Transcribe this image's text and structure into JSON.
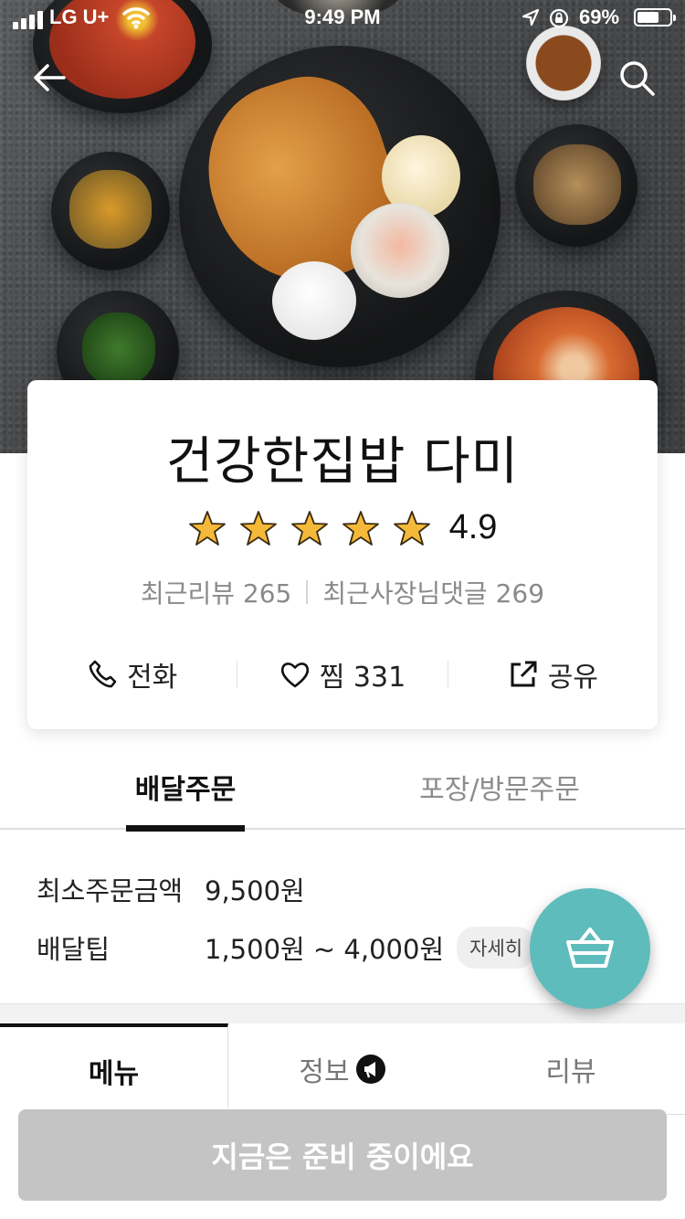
{
  "status_bar": {
    "carrier": "LG U+",
    "time": "9:49 PM",
    "battery_percent": "69%",
    "battery_level": 0.69
  },
  "nav": {
    "back_icon": "arrow-left-icon",
    "search_icon": "search-icon"
  },
  "store": {
    "name": "건강한집밥 다미",
    "rating": "4.9",
    "star_count": 5,
    "recent_reviews": "최근리뷰 265",
    "owner_replies": "최근사장님댓글 269"
  },
  "actions": {
    "call_label": "전화",
    "like_label": "찜 331",
    "share_label": "공유"
  },
  "order_tabs": {
    "delivery_label": "배달주문",
    "pickup_label": "포장/방문주문"
  },
  "delivery_info": {
    "min_order_label": "최소주문금액",
    "min_order_value": "9,500원",
    "tip_label": "배달팁",
    "tip_value": "1,500원 ~ 4,000원",
    "detail_label": "자세히"
  },
  "menu_tabs": {
    "menu_label": "메뉴",
    "info_label": "정보",
    "review_label": "리뷰"
  },
  "bottom_button": {
    "label": "지금은 준비 중이에요"
  },
  "colors": {
    "accent_teal": "#5fbcbc",
    "star_gold": "#f5b93a",
    "disabled_button": "#c4c4c4"
  }
}
